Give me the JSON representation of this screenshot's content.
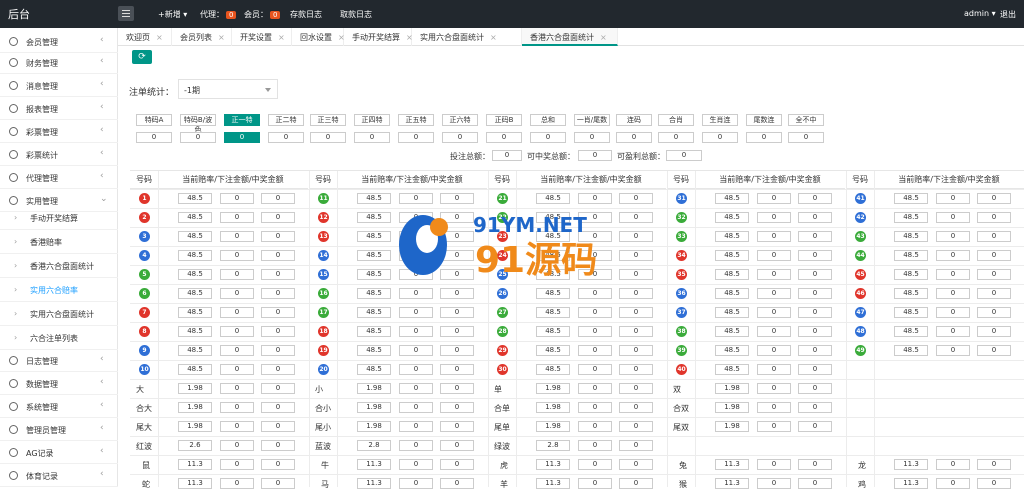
{
  "topbar": {
    "title": "后台",
    "new_label": "+新增",
    "agent_label": "代理：",
    "agent_count": "0",
    "member_label": "会员：",
    "member_count": "0",
    "deposit_log": "存款日志",
    "withdraw_log": "取款日志",
    "user": "admin",
    "logout": "退出"
  },
  "sidebar": {
    "items": [
      {
        "label": "会员管理",
        "icon": "user-icon"
      },
      {
        "label": "财务管理",
        "icon": "finance-icon"
      },
      {
        "label": "消息管理",
        "icon": "message-icon"
      },
      {
        "label": "报表管理",
        "icon": "report-icon"
      },
      {
        "label": "彩票管理",
        "icon": "lottery-icon"
      },
      {
        "label": "彩票统计",
        "icon": "lottery-stats-icon"
      },
      {
        "label": "代理管理",
        "icon": "agent-icon"
      },
      {
        "label": "实用管理",
        "icon": "tools-icon"
      }
    ],
    "sub_items": [
      {
        "label": "手动开奖结算"
      },
      {
        "label": "香港赔率"
      },
      {
        "label": "香港六合盘面统计"
      },
      {
        "label": "实用六合赔率"
      },
      {
        "label": "实用六合盘面统计"
      },
      {
        "label": "六合注单列表"
      }
    ],
    "items2": [
      {
        "label": "日志管理"
      },
      {
        "label": "数据管理"
      },
      {
        "label": "系统管理"
      },
      {
        "label": "管理员管理"
      },
      {
        "label": "AG记录"
      },
      {
        "label": "体育记录"
      }
    ]
  },
  "tabs": [
    "欢迎页",
    "会员列表",
    "开奖设置",
    "回水设置",
    "手动开奖结算",
    "实用六合盘面统计",
    "香港六合盘面统计"
  ],
  "filter": {
    "label": "注单统计：",
    "period": "-1期"
  },
  "types": [
    "特码A",
    "特码B/波色",
    "正一特",
    "正二特",
    "正三特",
    "正四特",
    "正五特",
    "正六特",
    "正码B",
    "总和",
    "一肖/尾数",
    "连码",
    "合肖",
    "生肖连",
    "尾数连",
    "全不中"
  ],
  "type_values": [
    "0",
    "0",
    "0",
    "0",
    "0",
    "0",
    "0",
    "0",
    "0",
    "0",
    "0",
    "0",
    "0",
    "0",
    "0",
    "0"
  ],
  "summary": {
    "bet_total_label": "投注总额：",
    "bet_total": "0",
    "win_total_label": "可中奖总额：",
    "win_total": "0",
    "profit_total_label": "可盈利总额：",
    "profit_total": "0"
  },
  "grid": {
    "num_header": "号码",
    "odds_header": "当前赔率/下注金额/中奖金额",
    "odds": "48.5",
    "zero": "0",
    "extra_rows": [
      [
        "大",
        "1.98",
        "小",
        "1.98",
        "单",
        "1.98",
        "双",
        "1.98"
      ],
      [
        "合大",
        "1.98",
        "合小",
        "1.98",
        "合单",
        "1.98",
        "合双",
        "1.98"
      ],
      [
        "尾大",
        "1.98",
        "尾小",
        "1.98",
        "尾单",
        "1.98",
        "尾双",
        "1.98"
      ],
      [
        "红波",
        "2.6",
        "蓝波",
        "2.8",
        "绿波",
        "2.8"
      ]
    ],
    "zodiac_rows": [
      [
        "鼠",
        "11.3",
        "牛",
        "11.3",
        "虎",
        "11.3",
        "兔",
        "11.3",
        "龙",
        "11.3"
      ],
      [
        "蛇",
        "11.3",
        "马",
        "11.3",
        "羊",
        "11.3",
        "猴",
        "11.3",
        "鸡",
        "11.3"
      ]
    ]
  },
  "ball_colors": {
    "red": "#e0352b",
    "blue": "#2f6fd6",
    "green": "#3aab3a"
  },
  "watermark": {
    "text1": "91YM.NET",
    "text2": "91源码"
  }
}
